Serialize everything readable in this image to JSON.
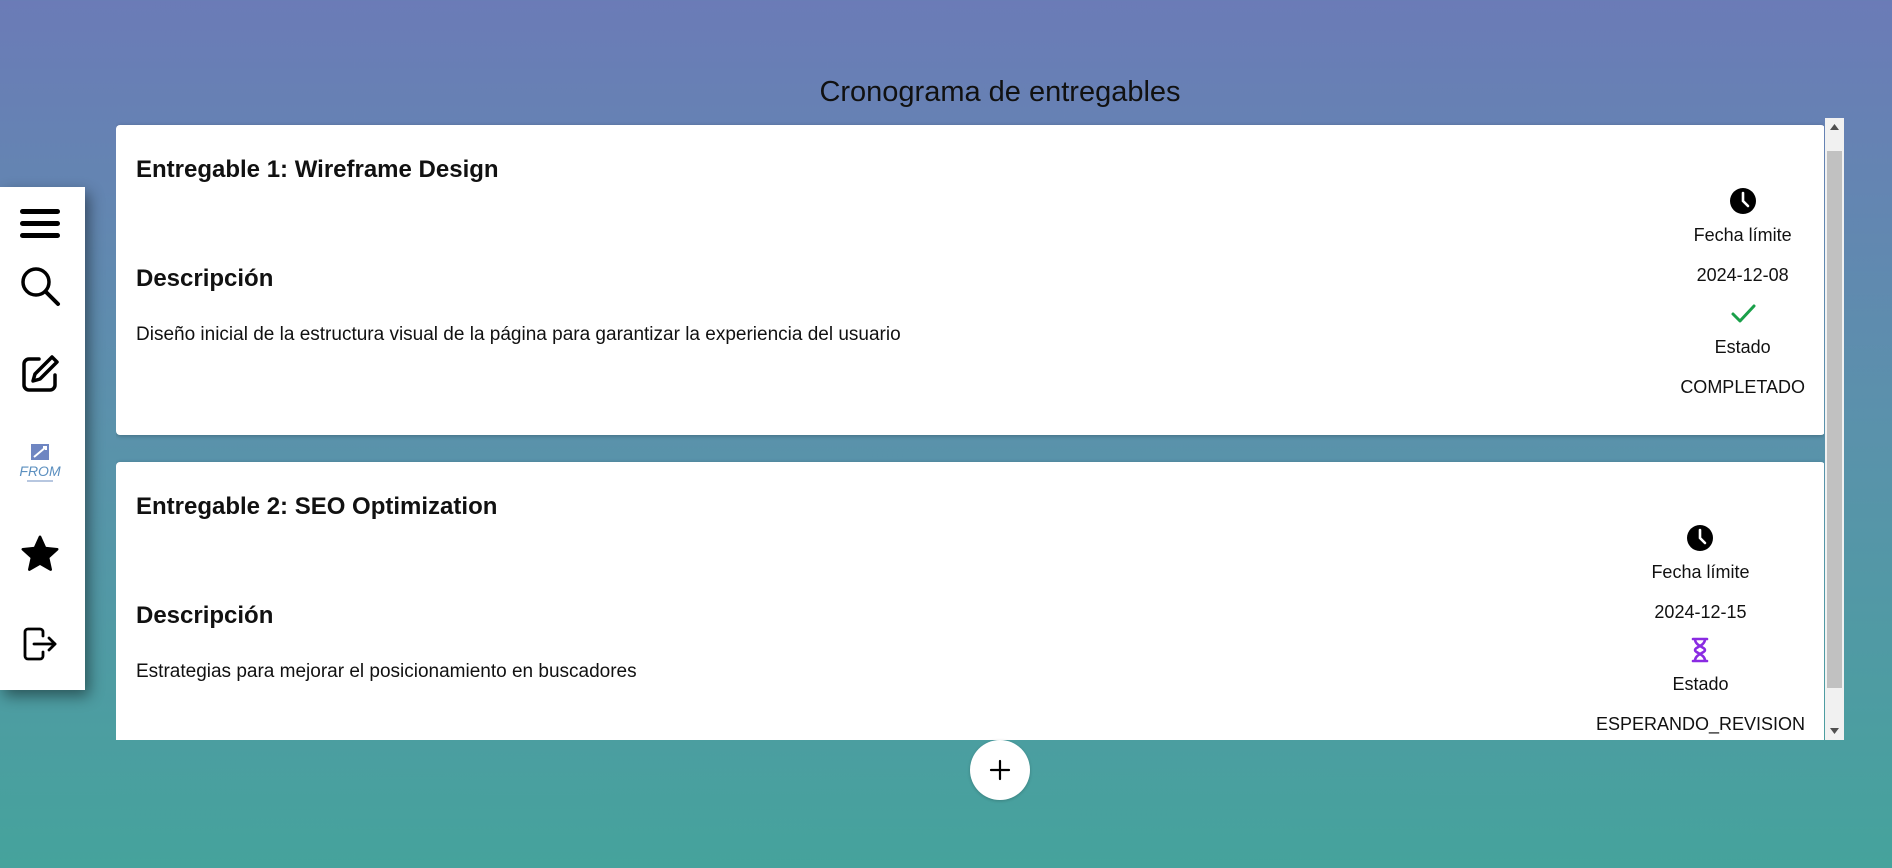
{
  "page": {
    "title": "Cronograma de entregables"
  },
  "sidebar": {
    "items": [
      {
        "name": "menu-icon"
      },
      {
        "name": "search-icon"
      },
      {
        "name": "edit-icon"
      },
      {
        "name": "logo",
        "text": "FROM"
      },
      {
        "name": "star-icon"
      },
      {
        "name": "logout-icon"
      }
    ]
  },
  "deliverables": [
    {
      "title": "Entregable 1: Wireframe Design",
      "description_heading": "Descripción",
      "description": "Diseño inicial de la estructura visual de la página para garantizar la experiencia del usuario",
      "deadline_label": "Fecha límite",
      "deadline": "2024-12-08",
      "status_label": "Estado",
      "status": "COMPLETADO",
      "status_icon": "check-icon",
      "status_color": "#1aa04a"
    },
    {
      "title": "Entregable 2: SEO Optimization",
      "description_heading": "Descripción",
      "description": "Estrategias para mejorar el posicionamiento en buscadores",
      "deadline_label": "Fecha límite",
      "deadline": "2024-12-15",
      "status_label": "Estado",
      "status": "ESPERANDO_REVISION",
      "status_icon": "hourglass-icon",
      "status_color": "#8a2be2"
    }
  ],
  "add_button": {
    "icon": "plus-icon",
    "label": "+"
  },
  "colors": {
    "bg_top": "#6b7bb7",
    "bg_bottom": "#45a39c",
    "card": "#ffffff"
  }
}
